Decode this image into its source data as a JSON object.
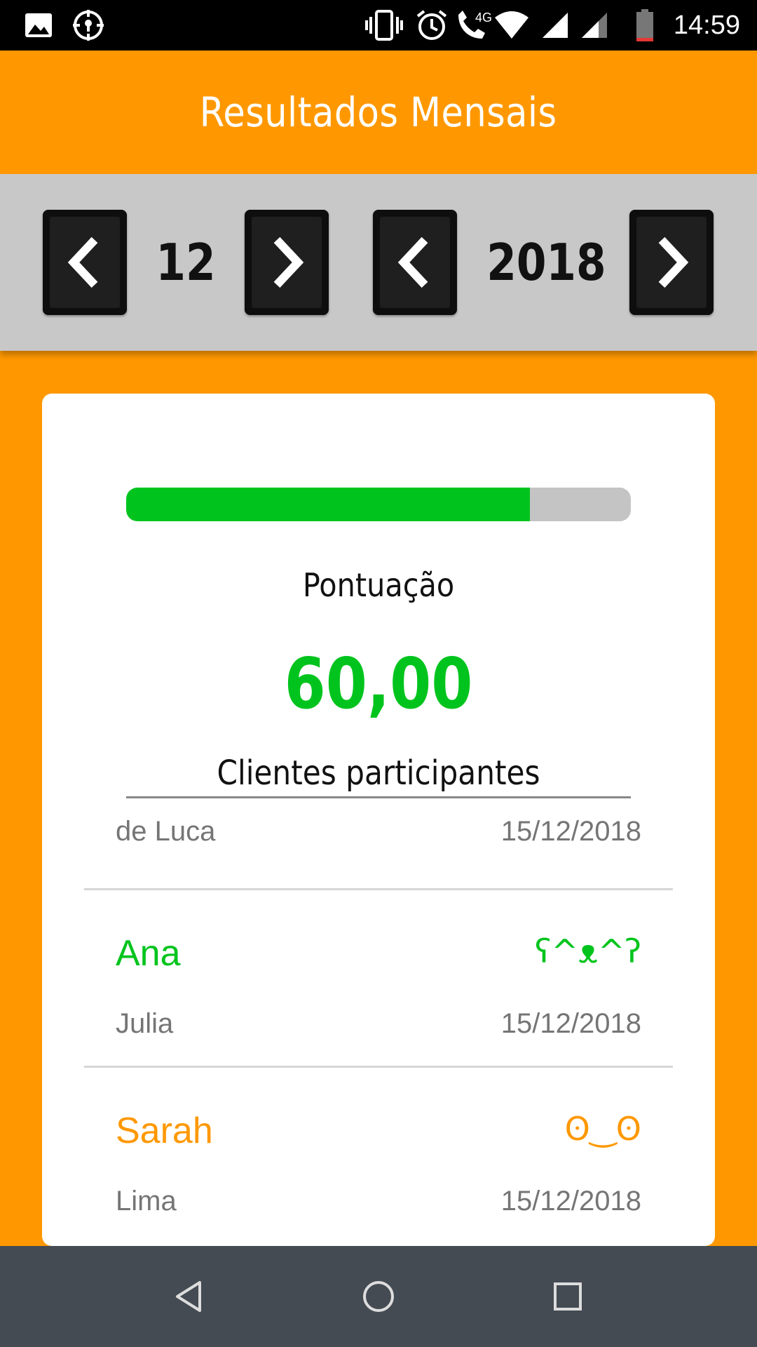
{
  "status_bar": {
    "time": "14:59",
    "left_icons": [
      "image-icon",
      "location-icon"
    ],
    "right_icons": [
      "vibrate-icon",
      "alarm-icon",
      "volte-4g-call-icon",
      "wifi-icon",
      "signal-icon",
      "signal-icon-2",
      "battery-icon"
    ],
    "network_label": "4G"
  },
  "app_bar": {
    "title": "Resultados Mensais"
  },
  "date_selector": {
    "month": "12",
    "year": "2018"
  },
  "score": {
    "progress_fraction": 0.8,
    "label": "Pontuação",
    "value": "60,00"
  },
  "clients": {
    "title": "Clientes participantes",
    "rows": [
      {
        "name": "",
        "emote": "",
        "surname": "de Luca",
        "date": "15/12/2018"
      },
      {
        "name": "Ana",
        "emote": "ʕ^ᴥ^ʔ",
        "surname": "Julia",
        "date": "15/12/2018",
        "accent": "#00c41d"
      },
      {
        "name": "Sarah",
        "emote": "ʘ‿ʘ",
        "surname": "Lima",
        "date": "15/12/2018",
        "accent": "#ff9800"
      }
    ]
  },
  "colors": {
    "primary": "#ff9800",
    "success": "#00c41d",
    "selector_bg": "#c8c8c8",
    "nav_bar": "#444b52"
  }
}
